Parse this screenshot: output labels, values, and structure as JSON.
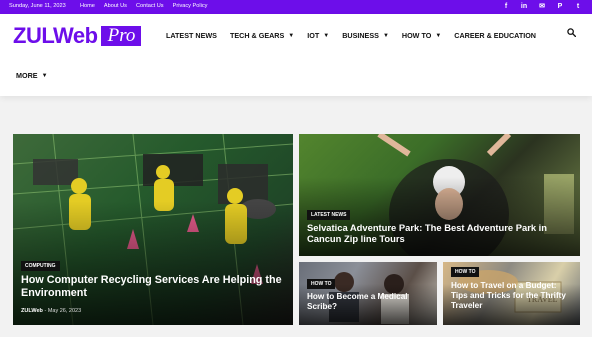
{
  "topbar": {
    "date": "Sunday, June 11, 2023",
    "links": [
      "Home",
      "About Us",
      "Contact Us",
      "Privacy Policy"
    ],
    "social": [
      {
        "icon": "facebook-icon",
        "glyph": "f"
      },
      {
        "icon": "linkedin-icon",
        "glyph": "in"
      },
      {
        "icon": "mail-icon",
        "glyph": "✉"
      },
      {
        "icon": "pinterest-icon",
        "glyph": "P"
      },
      {
        "icon": "twitter-icon",
        "glyph": "t"
      }
    ]
  },
  "logo": {
    "main": "ZULWeb",
    "badge": "Pro"
  },
  "nav": {
    "items": [
      {
        "label": "LATEST NEWS",
        "dropdown": false
      },
      {
        "label": "TECH & GEARS",
        "dropdown": true
      },
      {
        "label": "IOT",
        "dropdown": true
      },
      {
        "label": "BUSINESS",
        "dropdown": true
      },
      {
        "label": "HOW TO",
        "dropdown": true
      },
      {
        "label": "CAREER & EDUCATION",
        "dropdown": false
      }
    ],
    "more": "MORE",
    "search_icon": "search-icon"
  },
  "featured": [
    {
      "category": "COMPUTING",
      "title": "How Computer Recycling Services Are Helping the Environment",
      "author": "ZULWeb",
      "date": "May 26, 2023"
    },
    {
      "category": "LATEST NEWS",
      "title": "Selvatica Adventure Park: The Best Adventure Park in Cancun Zip line Tours"
    },
    {
      "category": "HOW TO",
      "title": "How to Become a Medical Scribe?"
    },
    {
      "category": "HOW TO",
      "title": "How to Travel on a Budget: Tips and Tricks for the Thrifty Traveler"
    }
  ],
  "colors": {
    "brand": "#6d0eea",
    "badge": "#111111"
  }
}
